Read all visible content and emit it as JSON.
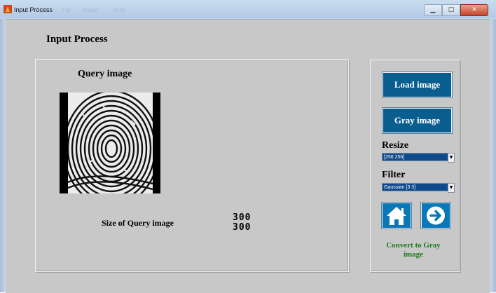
{
  "window": {
    "title": "Input Process",
    "menu_faded": [
      "Fig",
      "Radar",
      "Wide"
    ]
  },
  "main": {
    "heading": "Input Process",
    "query_title": "Query image",
    "size_label": "Size of Query image",
    "size_values": [
      "300",
      "300"
    ]
  },
  "side": {
    "load_button": "Load image",
    "gray_button": "Gray image",
    "resize_label": "Resize",
    "resize_selected": "[256 256]",
    "filter_label": "Filter",
    "filter_selected": "Gaussian [3 3]",
    "status_text": "Convert to Gray image"
  },
  "icons": {
    "home": "home-icon",
    "next": "arrow-right-circle-icon"
  }
}
